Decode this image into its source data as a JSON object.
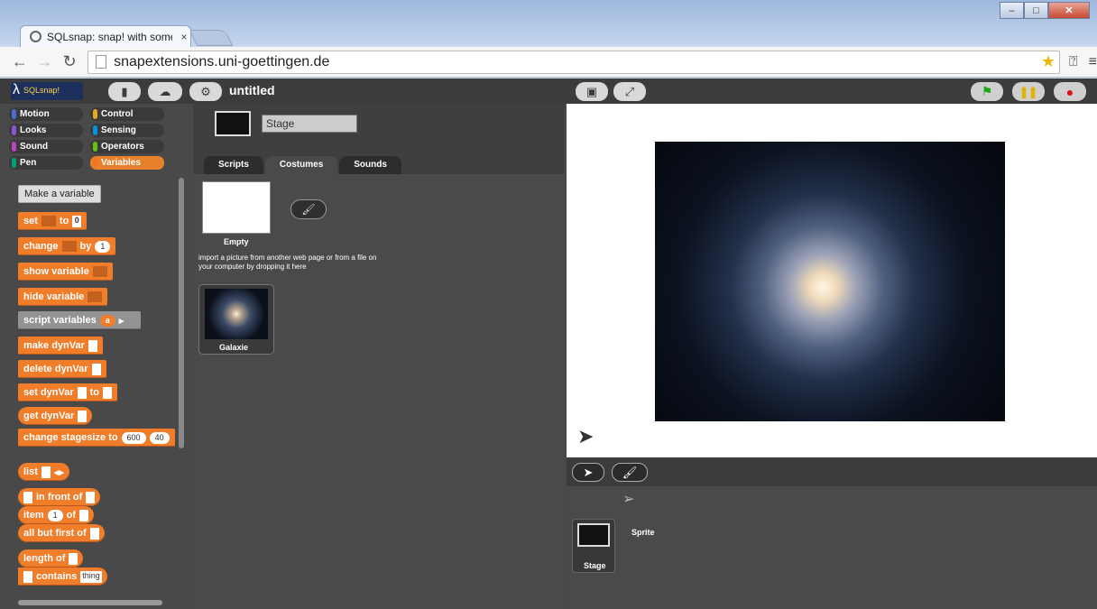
{
  "browser": {
    "tab_title": "SQLsnap: snap! with some",
    "url": "snapextensions.uni-goettingen.de"
  },
  "app": {
    "logo_text": "SQLsnap!",
    "project_title": "untitled"
  },
  "categories": [
    {
      "label": "Motion",
      "color": "#4a6cd4"
    },
    {
      "label": "Control",
      "color": "#e6a822"
    },
    {
      "label": "Looks",
      "color": "#8a55d7"
    },
    {
      "label": "Sensing",
      "color": "#0494dc"
    },
    {
      "label": "Sound",
      "color": "#bb42c3"
    },
    {
      "label": "Operators",
      "color": "#62c213"
    },
    {
      "label": "Pen",
      "color": "#00a178"
    },
    {
      "label": "Variables",
      "color": "#f3761d"
    }
  ],
  "palette": {
    "make_variable": "Make a variable",
    "set": "set",
    "to": "to",
    "set_value": "0",
    "change": "change",
    "by": "by",
    "change_value": "1",
    "show_variable": "show variable",
    "hide_variable": "hide variable",
    "script_variables": "script variables",
    "script_var_name": "a",
    "make_dynvar": "make dynVar",
    "delete_dynvar": "delete dynVar",
    "set_dynvar": "set dynVar",
    "set_dynvar_to": "to",
    "get_dynvar": "get dynVar",
    "change_stagesize": "change stagesize to",
    "stagesize_w": "600",
    "stagesize_h": "40",
    "list": "list",
    "in_front_of": "in front of",
    "item": "item",
    "item_value": "1",
    "of": "of",
    "all_but_first": "all but first of",
    "length_of": "length of",
    "contains": "contains",
    "contains_value": "thing"
  },
  "sprite": {
    "name": "Stage",
    "tabs": [
      "Scripts",
      "Costumes",
      "Sounds"
    ]
  },
  "costumes": {
    "empty_label": "Empty",
    "import_hint": "import a picture from another web page or from a file on your computer by dropping it here",
    "items": [
      "Galaxie"
    ]
  },
  "corral": {
    "sprite_label": "Sprite",
    "stage_label": "Stage"
  }
}
